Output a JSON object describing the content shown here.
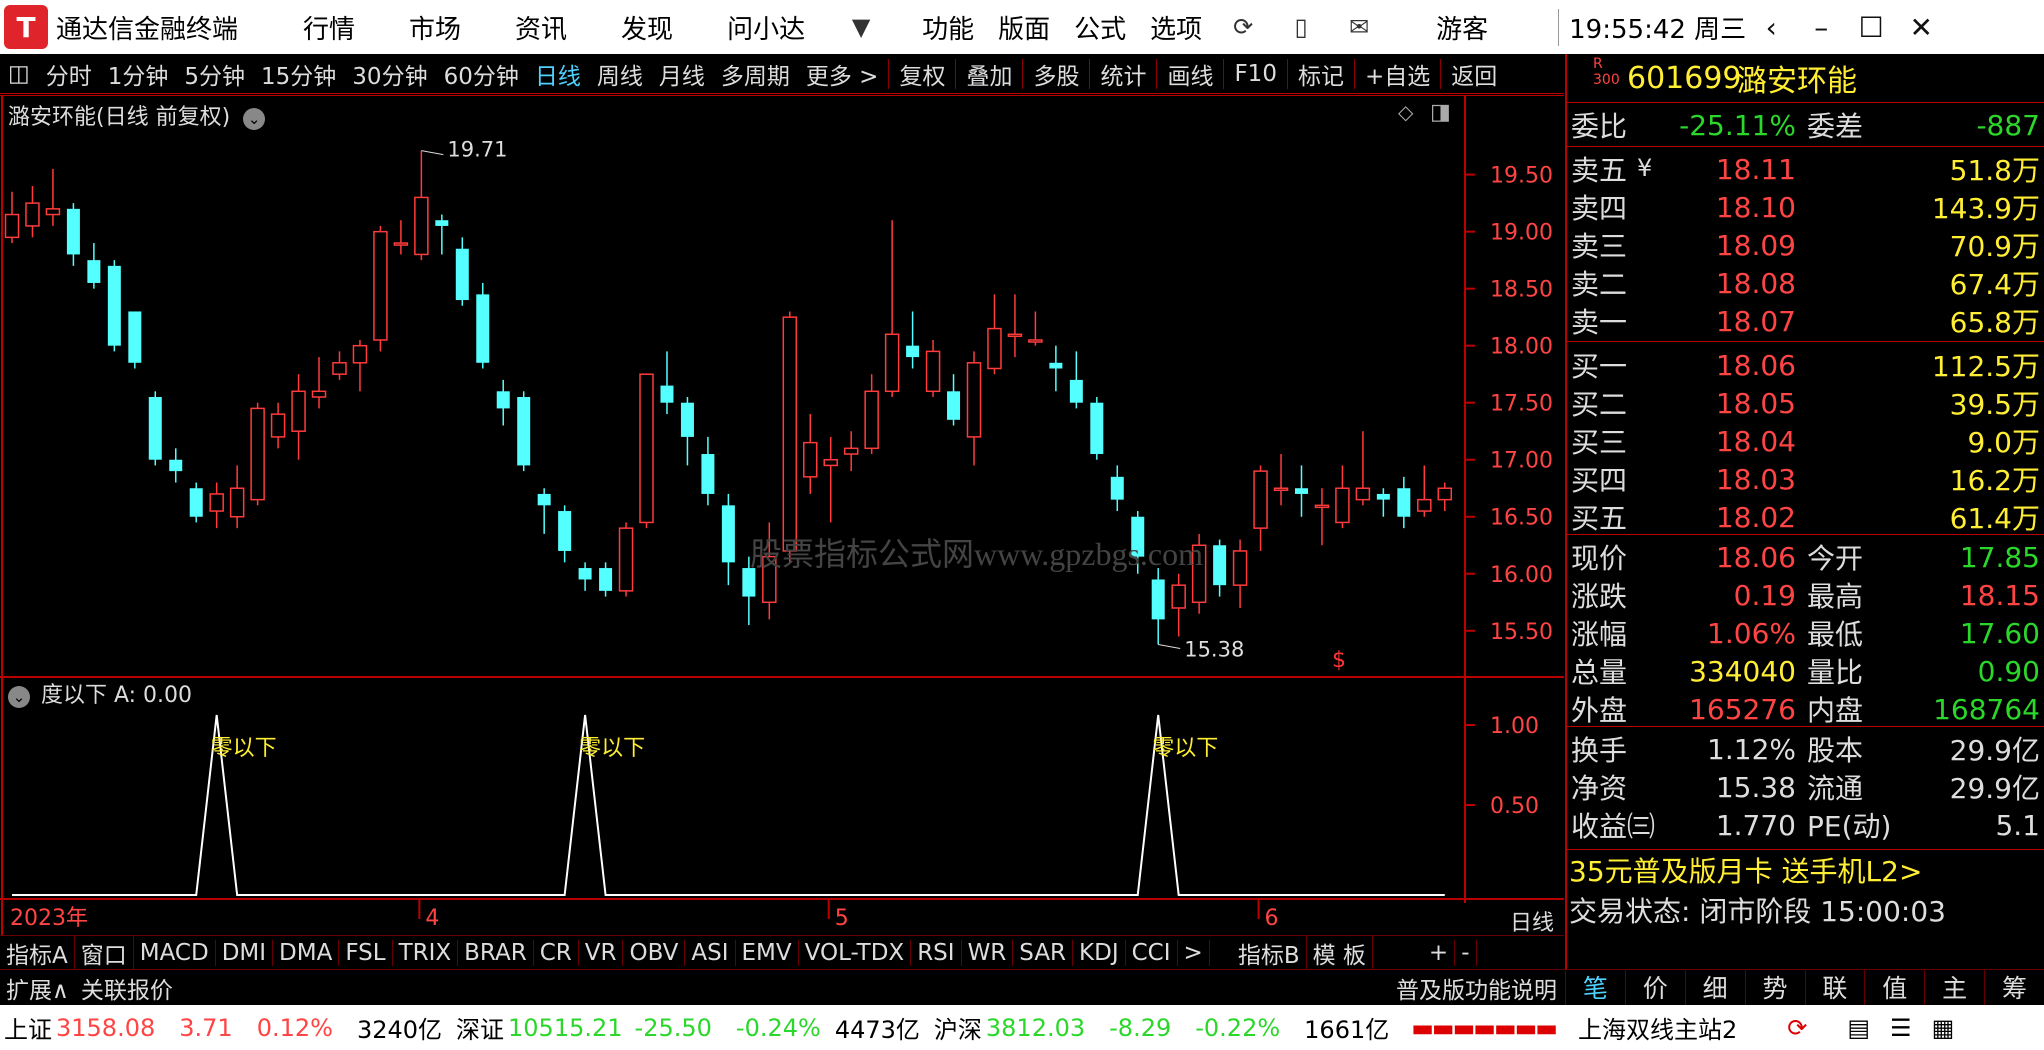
{
  "app": {
    "title": "通达信金融终端",
    "menu": [
      "行情",
      "市场",
      "资讯",
      "发现",
      "问小达"
    ],
    "menu2": [
      "功能",
      "版面",
      "公式",
      "选项"
    ],
    "user": "游客",
    "clock": "19:55:42 周三"
  },
  "periods": [
    "分时",
    "1分钟",
    "5分钟",
    "15分钟",
    "30分钟",
    "60分钟",
    "日线",
    "周线",
    "月线",
    "多周期",
    "更多 >"
  ],
  "period_active": "日线",
  "tools": [
    "复权",
    "叠加",
    "多股",
    "统计",
    "画线",
    "F10",
    "标记",
    "+自选",
    "返回"
  ],
  "chart": {
    "title": "潞安环能(日线 前复权)",
    "max_label": "19.71",
    "min_label": "15.38",
    "watermark": "股票指标公式网www.gpzbgs.com",
    "ticks": [
      "19.50",
      "19.00",
      "18.50",
      "18.00",
      "17.50",
      "17.00",
      "16.50",
      "16.00",
      "15.50"
    ],
    "sub_title": "度以下  A: 0.00",
    "sub_ticks": [
      "1.00",
      "0.50"
    ],
    "signal_label": "零以下",
    "date_labels": [
      "2023年",
      "4",
      "5",
      "6"
    ],
    "period_label": "日线"
  },
  "chart_data": {
    "type": "candlestick",
    "ylim": [
      15.2,
      19.9
    ],
    "candles": [
      [
        18.95,
        19.15,
        19.35,
        18.9
      ],
      [
        19.05,
        19.25,
        19.4,
        18.95
      ],
      [
        19.15,
        19.2,
        19.55,
        19.05
      ],
      [
        19.2,
        18.8,
        19.25,
        18.7
      ],
      [
        18.75,
        18.55,
        18.9,
        18.5
      ],
      [
        18.7,
        18.0,
        18.75,
        17.95
      ],
      [
        18.3,
        17.85,
        18.3,
        17.8
      ],
      [
        17.55,
        17.0,
        17.6,
        16.95
      ],
      [
        17.0,
        16.9,
        17.1,
        16.8
      ],
      [
        16.75,
        16.5,
        16.8,
        16.45
      ],
      [
        16.55,
        16.7,
        16.8,
        16.4
      ],
      [
        16.5,
        16.75,
        16.95,
        16.4
      ],
      [
        16.65,
        17.45,
        17.5,
        16.6
      ],
      [
        17.2,
        17.4,
        17.5,
        17.1
      ],
      [
        17.25,
        17.6,
        17.75,
        17.0
      ],
      [
        17.55,
        17.6,
        17.9,
        17.45
      ],
      [
        17.75,
        17.85,
        17.95,
        17.7
      ],
      [
        17.85,
        18.0,
        18.05,
        17.6
      ],
      [
        18.05,
        19.0,
        19.05,
        17.95
      ],
      [
        18.9,
        18.9,
        19.1,
        18.8
      ],
      [
        18.8,
        19.3,
        19.71,
        18.75
      ],
      [
        19.1,
        19.05,
        19.15,
        18.8
      ],
      [
        18.85,
        18.4,
        18.95,
        18.35
      ],
      [
        18.45,
        17.85,
        18.55,
        17.8
      ],
      [
        17.6,
        17.45,
        17.7,
        17.3
      ],
      [
        17.55,
        16.95,
        17.6,
        16.9
      ],
      [
        16.7,
        16.6,
        16.75,
        16.35
      ],
      [
        16.55,
        16.2,
        16.6,
        16.1
      ],
      [
        16.05,
        15.95,
        16.1,
        15.85
      ],
      [
        16.05,
        15.85,
        16.1,
        15.8
      ],
      [
        15.85,
        16.4,
        16.45,
        15.8
      ],
      [
        16.45,
        17.75,
        17.75,
        16.4
      ],
      [
        17.65,
        17.5,
        17.95,
        17.4
      ],
      [
        17.5,
        17.2,
        17.55,
        16.95
      ],
      [
        17.05,
        16.7,
        17.2,
        16.6
      ],
      [
        16.6,
        16.1,
        16.7,
        15.9
      ],
      [
        16.05,
        15.8,
        16.15,
        15.55
      ],
      [
        15.75,
        16.15,
        16.45,
        15.6
      ],
      [
        16.2,
        18.25,
        18.3,
        16.1
      ],
      [
        16.85,
        17.15,
        17.4,
        16.7
      ],
      [
        16.95,
        17.0,
        17.2,
        16.45
      ],
      [
        17.05,
        17.1,
        17.25,
        16.9
      ],
      [
        17.1,
        17.6,
        17.75,
        17.05
      ],
      [
        17.6,
        18.1,
        19.1,
        17.55
      ],
      [
        18.0,
        17.9,
        18.3,
        17.8
      ],
      [
        17.6,
        17.95,
        18.05,
        17.55
      ],
      [
        17.6,
        17.35,
        17.75,
        17.3
      ],
      [
        17.2,
        17.85,
        17.95,
        16.95
      ],
      [
        17.8,
        18.15,
        18.45,
        17.75
      ],
      [
        18.1,
        18.1,
        18.45,
        17.9
      ],
      [
        18.05,
        18.05,
        18.3,
        18.0
      ],
      [
        17.85,
        17.8,
        18.0,
        17.6
      ],
      [
        17.7,
        17.5,
        17.95,
        17.45
      ],
      [
        17.5,
        17.05,
        17.55,
        17.0
      ],
      [
        16.85,
        16.65,
        16.95,
        16.55
      ],
      [
        16.5,
        16.15,
        16.55,
        16.0
      ],
      [
        15.95,
        15.6,
        16.05,
        15.38
      ],
      [
        15.7,
        15.9,
        16.0,
        15.45
      ],
      [
        15.75,
        16.25,
        16.35,
        15.65
      ],
      [
        16.25,
        15.9,
        16.3,
        15.8
      ],
      [
        15.9,
        16.2,
        16.3,
        15.7
      ],
      [
        16.4,
        16.9,
        16.95,
        16.2
      ],
      [
        16.75,
        16.75,
        17.05,
        16.6
      ],
      [
        16.75,
        16.7,
        16.95,
        16.5
      ],
      [
        16.6,
        16.6,
        16.75,
        16.25
      ],
      [
        16.45,
        16.75,
        16.95,
        16.4
      ],
      [
        16.65,
        16.75,
        17.25,
        16.6
      ],
      [
        16.7,
        16.65,
        16.75,
        16.5
      ],
      [
        16.75,
        16.5,
        16.85,
        16.4
      ],
      [
        16.55,
        16.65,
        16.95,
        16.5
      ],
      [
        16.65,
        16.75,
        16.8,
        16.55
      ]
    ],
    "signal_indices": [
      10,
      28,
      56
    ]
  },
  "quote": {
    "code": "601699",
    "name": "潞安环能",
    "weibi_label": "委比",
    "weibi": "-25.11%",
    "weicha_label": "委差",
    "weicha": "-887",
    "asks": [
      {
        "label": "卖五",
        "price": "18.11",
        "vol": "51.8万"
      },
      {
        "label": "卖四",
        "price": "18.10",
        "vol": "143.9万"
      },
      {
        "label": "卖三",
        "price": "18.09",
        "vol": "70.9万"
      },
      {
        "label": "卖二",
        "price": "18.08",
        "vol": "67.4万"
      },
      {
        "label": "卖一",
        "price": "18.07",
        "vol": "65.8万"
      }
    ],
    "bids": [
      {
        "label": "买一",
        "price": "18.06",
        "vol": "112.5万"
      },
      {
        "label": "买二",
        "price": "18.05",
        "vol": "39.5万"
      },
      {
        "label": "买三",
        "price": "18.04",
        "vol": "9.0万"
      },
      {
        "label": "买四",
        "price": "18.03",
        "vol": "16.2万"
      },
      {
        "label": "买五",
        "price": "18.02",
        "vol": "61.4万"
      }
    ],
    "stats": [
      {
        "l1": "现价",
        "v1": "18.06",
        "c1": "red",
        "l2": "今开",
        "v2": "17.85",
        "c2": "green"
      },
      {
        "l1": "涨跌",
        "v1": "0.19",
        "c1": "red",
        "l2": "最高",
        "v2": "18.15",
        "c2": "red"
      },
      {
        "l1": "涨幅",
        "v1": "1.06%",
        "c1": "red",
        "l2": "最低",
        "v2": "17.60",
        "c2": "green"
      },
      {
        "l1": "总量",
        "v1": "334040",
        "c1": "yellow",
        "l2": "量比",
        "v2": "0.90",
        "c2": "green"
      },
      {
        "l1": "外盘",
        "v1": "165276",
        "c1": "red",
        "l2": "内盘",
        "v2": "168764",
        "c2": "green"
      }
    ],
    "stats2": [
      {
        "l1": "换手",
        "v1": "1.12%",
        "l2": "股本",
        "v2": "29.9亿"
      },
      {
        "l1": "净资",
        "v1": "15.38",
        "l2": "流通",
        "v2": "29.9亿"
      },
      {
        "l1": "收益㈢",
        "v1": "1.770",
        "l2": "PE(动)",
        "v2": "5.1"
      }
    ],
    "promo": "35元普及版月卡 送手机L2>",
    "trade_state": "交易状态: 闭市阶段  15:00:03"
  },
  "indicators": [
    "指标A",
    "窗口",
    "MACD",
    "DMI",
    "DMA",
    "FSL",
    "TRIX",
    "BRAR",
    "CR",
    "VR",
    "OBV",
    "ASI",
    "EMV",
    "VOL-TDX",
    "RSI",
    "WR",
    "SAR",
    "KDJ",
    "CCI",
    ">",
    "指标B",
    "模 板",
    "+",
    "-"
  ],
  "ext": {
    "expand": "扩展∧",
    "related": "关联报价",
    "help": "普及版功能说明"
  },
  "right_tabs": [
    "笔",
    "价",
    "细",
    "势",
    "联",
    "值",
    "主",
    "筹"
  ],
  "status": {
    "sh_label": "上证",
    "sh": "3158.08",
    "sh_chg": "3.71",
    "sh_pct": "0.12%",
    "sh_amt": "3240亿",
    "sz_label": "深证",
    "sz": "10515.21",
    "sz_chg": "-25.50",
    "sz_pct": "-0.24%",
    "sz_amt": "4473亿",
    "hs_label": "沪深",
    "hs": "3812.03",
    "hs_chg": "-8.29",
    "hs_pct": "-0.22%",
    "hs_amt": "1661亿",
    "server": "上海双线主站2"
  },
  "colors": {
    "up": "#ff3b3b",
    "down": "#54ffff",
    "grid": "#b00000",
    "signal": "#ffffff"
  }
}
